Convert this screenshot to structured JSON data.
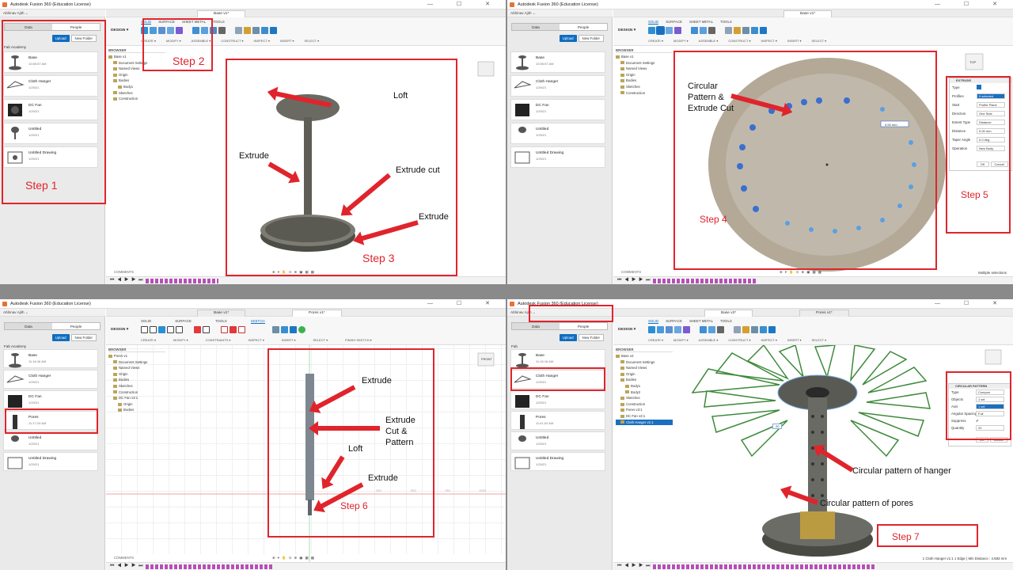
{
  "app_title": "Autodesk Fusion 360 (Education License)",
  "window_controls": "— ☐ ✕",
  "account": "Abhinav Ajith ⌄",
  "data_panel": {
    "tab_data": "Data",
    "tab_people": "People",
    "upload": "Upload",
    "new_folder": "New Folder",
    "project": "Fab Academy",
    "folder_short": "Fab",
    "version": "V1 ›"
  },
  "items_q0": [
    {
      "name": "Base",
      "time": "10:55:57 AM"
    },
    {
      "name": "Cloth Hanger",
      "time": "1/29/21"
    },
    {
      "name": "DC Fan",
      "time": "1/29/21"
    },
    {
      "name": "Untitled",
      "time": "1/29/21"
    },
    {
      "name": "Untitled Drawing",
      "time": "1/29/21"
    }
  ],
  "items_q2": [
    {
      "name": "Base",
      "time": "11:16:16 AM"
    },
    {
      "name": "Cloth Hanger",
      "time": "1/29/21"
    },
    {
      "name": "DC Fan",
      "time": "1/29/21"
    },
    {
      "name": "Pores",
      "time": "11:17:24 AM"
    },
    {
      "name": "Untitled",
      "time": "1/29/21"
    },
    {
      "name": "Untitled Drawing",
      "time": "1/29/21"
    }
  ],
  "items_q3": [
    {
      "name": "Base",
      "time": "11:16:16 AM"
    },
    {
      "name": "Cloth Hanger",
      "time": "1/29/21"
    },
    {
      "name": "DC Fan",
      "time": "1/29/21"
    },
    {
      "name": "Pores",
      "time": "11:41:02 AM"
    },
    {
      "name": "Untitled",
      "time": "1/29/21"
    },
    {
      "name": "Untitled Drawing",
      "time": "1/29/21"
    }
  ],
  "doc_tabs": {
    "base_v1": "Base v1*",
    "pores_v1": "Pores v1*",
    "base_v2": "Base v2*"
  },
  "ribbon": {
    "design": "DESIGN ▾",
    "tabs": [
      "SOLID",
      "SURFACE",
      "SHEET METAL",
      "TOOLS"
    ],
    "groups": [
      "CREATE ▾",
      "MODIFY ▾",
      "ASSEMBLE ▾",
      "CONSTRUCT ▾",
      "INSPECT ▾",
      "INSERT ▾",
      "SELECT ▾"
    ],
    "sketch_tabs": [
      "SOLID",
      "SURFACE",
      "TOOLS",
      "SKETCH"
    ],
    "sketch_groups": [
      "CREATE ▾",
      "MODIFY ▾",
      "CONSTRAINTS ▾",
      "INSPECT ▾",
      "INSERT ▾",
      "SELECT ▾",
      "FINISH SKETCH ▾"
    ]
  },
  "browser": {
    "title": "BROWSER",
    "rows_q0": [
      "Base v1",
      "Document Settings",
      "Named Views",
      "Origin",
      "Bodies",
      "Body1",
      "Sketches",
      "Construction"
    ],
    "rows_q1": [
      "Base v1",
      "Document Settings",
      "Named Views",
      "Origin",
      "Bodies",
      "Sketches",
      "Construction"
    ],
    "rows_q2": [
      "Pores v1",
      "Document Settings",
      "Named Views",
      "Origin",
      "Bodies",
      "Sketches",
      "Construction",
      "DC Fan v3:1",
      "Origin",
      "Bodies"
    ],
    "rows_q3": [
      "Base v2",
      "Document Settings",
      "Named Views",
      "Origin",
      "Bodies",
      "Body1",
      "Body2",
      "Sketches",
      "Construction",
      "Pores v3:1",
      "DC Fan v3:1",
      "Cloth Hanger v1:1"
    ]
  },
  "comments": "COMMENTS",
  "nav_icons": "⊕ ▾ ✋ ⊙ ⊕ ▣ ▦ ▦",
  "playback": "⏮ ◀ ▶ ▶ ⏭",
  "viewcube": {
    "q0": "",
    "q1": "TOP",
    "q2": "FRONT",
    "q3": ""
  },
  "extrude_panel": {
    "title": "EXTRUDE",
    "rows": [
      {
        "label": "Type",
        "value": ""
      },
      {
        "label": "Profiles",
        "value": "9 selected"
      },
      {
        "label": "Start",
        "value": "Profile Plane"
      },
      {
        "label": "Direction",
        "value": "One Side"
      },
      {
        "label": "Extent Type",
        "value": "Distance"
      },
      {
        "label": "Distance",
        "value": "0.00 mm"
      },
      {
        "label": "Taper Angle",
        "value": "0.0 deg"
      },
      {
        "label": "Operation",
        "value": "New Body"
      }
    ],
    "ok": "OK",
    "cancel": "Cancel",
    "dim": "0.00 mm"
  },
  "circular_panel": {
    "title": "CIRCULAR PATTERN",
    "rows": [
      {
        "label": "Type",
        "value": "Compon"
      },
      {
        "label": "Objects",
        "value": "1 sel"
      },
      {
        "label": "Axis",
        "value": "1 sel"
      },
      {
        "label": "Angular Spacing",
        "value": "Full"
      },
      {
        "label": "Suppress",
        "value": "✔"
      },
      {
        "label": "Quantity",
        "value": "20"
      }
    ],
    "ok": "OK",
    "cancel": "Cancel",
    "qty": "20"
  },
  "status": {
    "q1": "Multiple selections",
    "q3": "1 Cloth Hanger v1:1 1 Edge | Min Distance : 4.683 mm"
  },
  "rulers": [
    "250",
    "500",
    "750",
    "1000",
    "1250",
    "1500"
  ],
  "annotations": {
    "step1": "Step 1",
    "step2": "Step 2",
    "step3": "Step 3",
    "step4": "Step 4",
    "step5": "Step 5",
    "step6": "Step 6",
    "step7": "Step 7",
    "loft": "Loft",
    "extrude": "Extrude",
    "extrude_cut": "Extrude cut",
    "circular": "Circular\nPattern &\nExtrude Cut",
    "extrude_cut_pattern": "Extrude\nCut &\nPattern",
    "circ_hanger": "Circular pattern of hanger",
    "circ_pores": "Circular pattern of pores"
  }
}
